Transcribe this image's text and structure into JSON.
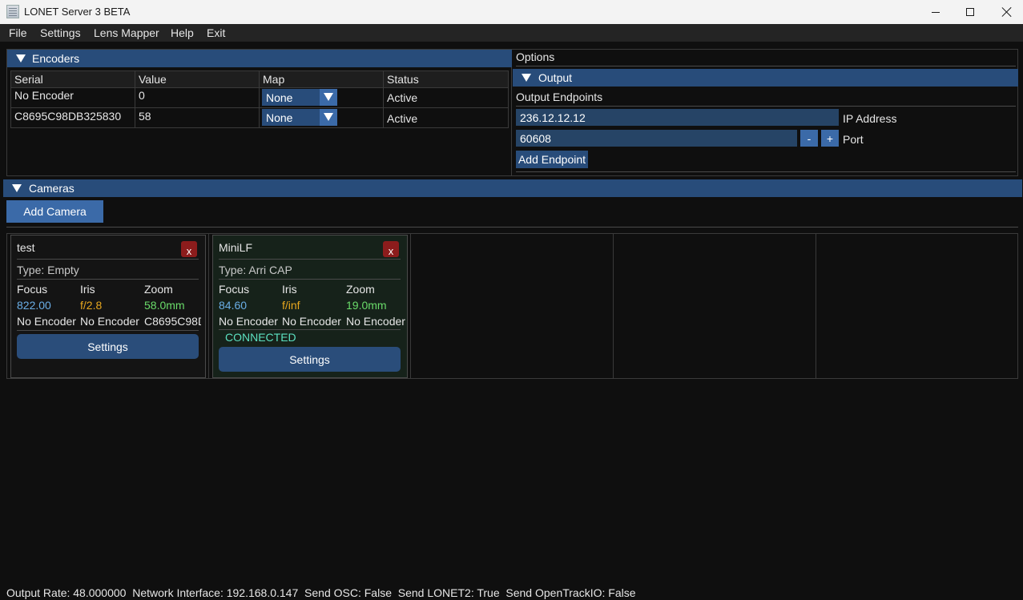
{
  "window": {
    "title": "LONET Server 3 BETA"
  },
  "menu": [
    "File",
    "Settings",
    "Lens Mapper",
    "Help",
    "Exit"
  ],
  "encoders": {
    "title": "Encoders",
    "columns": [
      "Serial",
      "Value",
      "Map",
      "Status"
    ],
    "rows": [
      {
        "serial": "No Encoder",
        "value": "0",
        "map": "None",
        "status": "Active"
      },
      {
        "serial": "C8695C98DB325830",
        "value": "58",
        "map": "None",
        "status": "Active"
      }
    ]
  },
  "options": {
    "title": "Options",
    "output_title": "Output",
    "endpoints_label": "Output Endpoints",
    "ip_value": "236.12.12.12",
    "ip_label": "IP Address",
    "port_value": "60608",
    "minus": "-",
    "plus": "+",
    "port_label": "Port",
    "add_endpoint": "Add Endpoint"
  },
  "cameras": {
    "title": "Cameras",
    "add_button": "Add Camera",
    "cards": [
      {
        "name": "test",
        "close": "x",
        "type": "Type: Empty",
        "focus_label": "Focus",
        "iris_label": "Iris",
        "zoom_label": "Zoom",
        "focus": "822.00",
        "iris": "f/2.8",
        "zoom": "58.0mm",
        "focus_enc": "No Encoder",
        "iris_enc": "No Encoder",
        "zoom_enc": "C8695C98D",
        "status": "",
        "settings": "Settings"
      },
      {
        "name": "MiniLF",
        "close": "x",
        "type": "Type: Arri CAP",
        "focus_label": "Focus",
        "iris_label": "Iris",
        "zoom_label": "Zoom",
        "focus": "84.60",
        "iris": "f/inf",
        "zoom": "19.0mm",
        "focus_enc": "No Encoder",
        "iris_enc": "No Encoder",
        "zoom_enc": "No Encoder",
        "status": "CONNECTED",
        "settings": "Settings"
      }
    ]
  },
  "status_bar": {
    "output_rate": "Output Rate: 48.000000",
    "network": "Network Interface: 192.168.0.147",
    "osc": "Send OSC: False",
    "lonet2": "Send LONET2: True",
    "opentrack": "Send OpenTrackIO: False"
  }
}
